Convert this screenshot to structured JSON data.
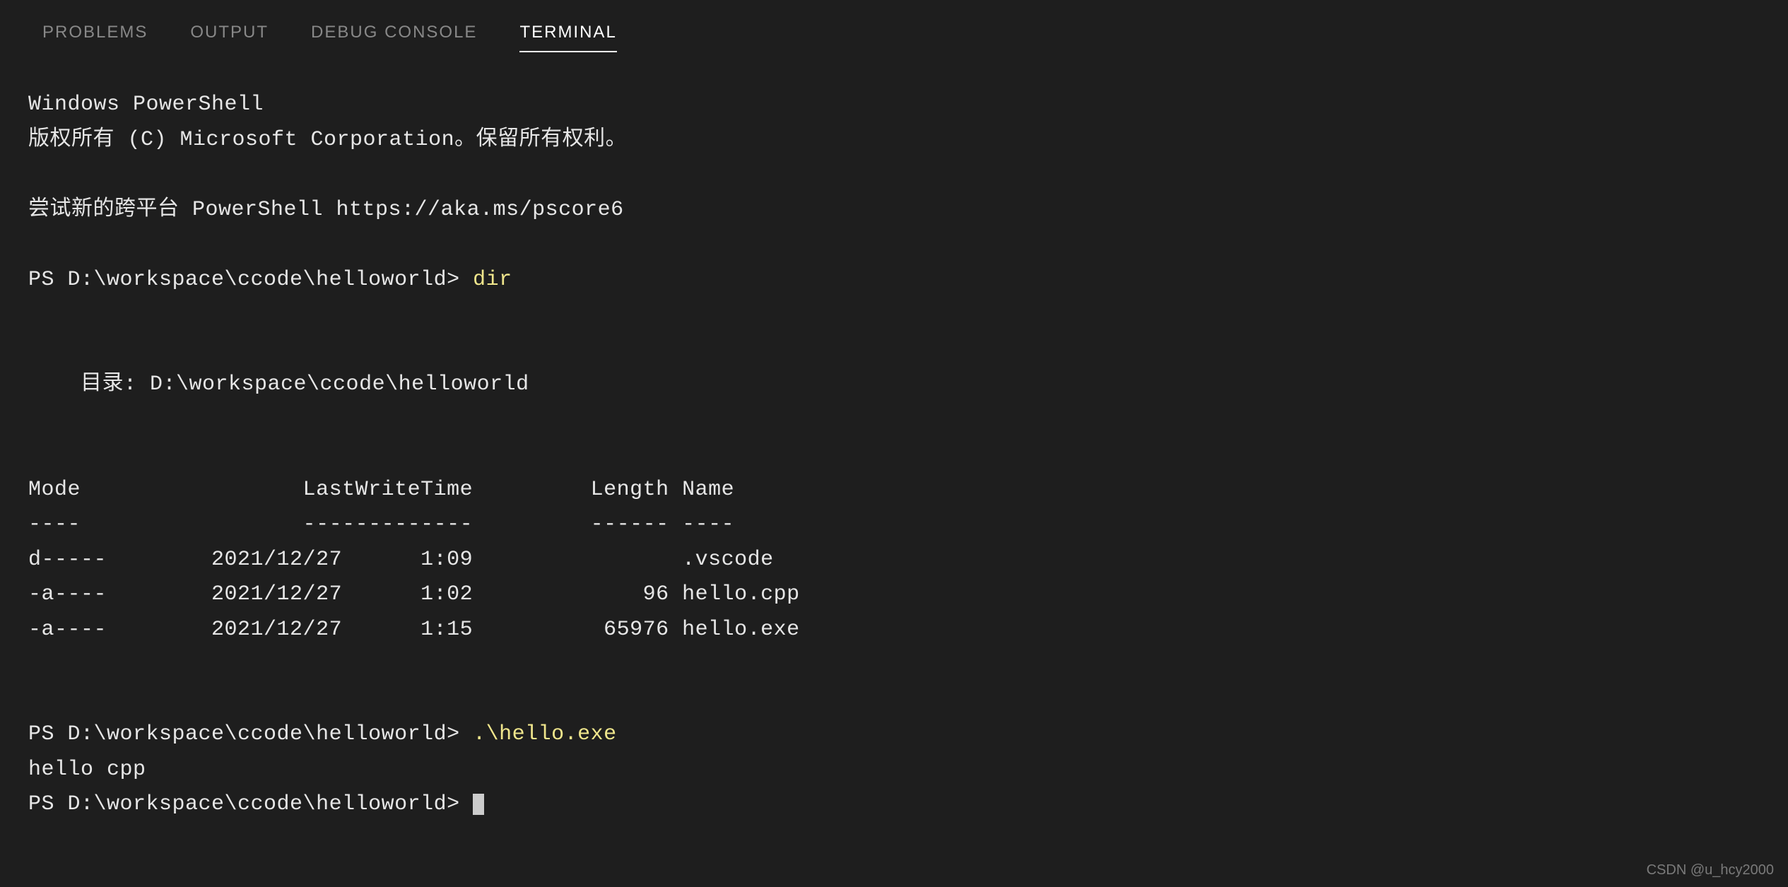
{
  "tabs": {
    "problems": "PROBLEMS",
    "output": "OUTPUT",
    "debug_console": "DEBUG CONSOLE",
    "terminal": "TERMINAL"
  },
  "terminal": {
    "header1": "Windows PowerShell",
    "header2": "版权所有 (C) Microsoft Corporation。保留所有权利。",
    "header3": "尝试新的跨平台 PowerShell https://aka.ms/pscore6",
    "prompt1_prefix": "PS D:\\workspace\\ccode\\helloworld> ",
    "cmd1": "dir",
    "dir_header": "    目录: D:\\workspace\\ccode\\helloworld",
    "table_header": "Mode                 LastWriteTime         Length Name",
    "table_divider": "----                 -------------         ------ ----",
    "row1": "d-----        2021/12/27      1:09                .vscode",
    "row2": "-a----        2021/12/27      1:02             96 hello.cpp",
    "row3": "-a----        2021/12/27      1:15          65976 hello.exe",
    "prompt2_prefix": "PS D:\\workspace\\ccode\\helloworld> ",
    "cmd2": ".\\hello.exe",
    "output2": "hello cpp",
    "prompt3_prefix": "PS D:\\workspace\\ccode\\helloworld> "
  },
  "watermark": "CSDN @u_hcy2000"
}
